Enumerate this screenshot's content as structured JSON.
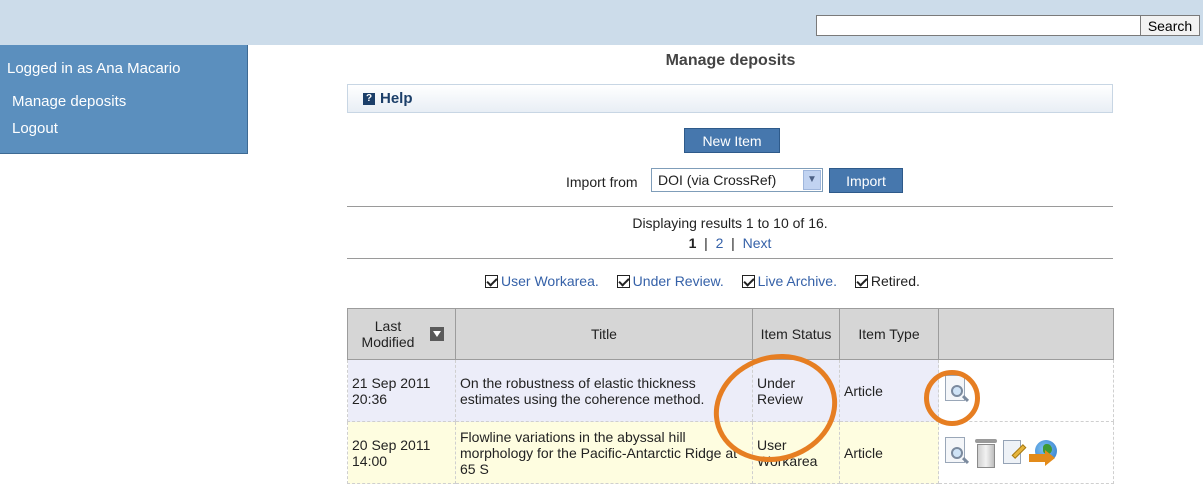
{
  "header": {
    "search_placeholder": "",
    "search_button": "Search"
  },
  "sidebar": {
    "logged_in": "Logged in as Ana Macario",
    "items": [
      {
        "label": "Manage deposits"
      },
      {
        "label": "Logout"
      }
    ]
  },
  "main": {
    "title": "Manage deposits",
    "help_label": "Help",
    "new_item_label": "New Item",
    "import": {
      "label": "Import from",
      "selected": "DOI (via CrossRef)",
      "button": "Import"
    },
    "results_text": "Displaying results 1 to 10 of 16.",
    "pager": {
      "current": "1",
      "sep": "|",
      "page2": "2",
      "next": "Next"
    },
    "filters": [
      {
        "label": "User Workarea.",
        "checked": true
      },
      {
        "label": "Under Review.",
        "checked": true
      },
      {
        "label": "Live Archive.",
        "checked": true
      },
      {
        "label": "Retired.",
        "checked": true
      }
    ]
  },
  "table": {
    "headers": {
      "last_modified": "Last Modified",
      "title": "Title",
      "item_status": "Item Status",
      "item_type": "Item Type"
    },
    "rows": [
      {
        "date": "21 Sep 2011 20:36",
        "title": "On the robustness of elastic thickness estimates using the coherence method.",
        "status": "Under Review",
        "type": "Article",
        "actions": [
          "preview-icon"
        ]
      },
      {
        "date": "20 Sep 2011 14:00",
        "title": "Flowline variations in the abyssal hill morphology for the Pacific-Antarctic Ridge at 65 S",
        "status": "User Workarea",
        "type": "Article",
        "actions": [
          "preview-icon",
          "trash-icon",
          "edit-icon",
          "deposit-globe-icon"
        ]
      }
    ]
  },
  "colors": {
    "topbar": "#ccdcea",
    "sidebar": "#5b8fbe",
    "button_blue": "#4677ad",
    "link": "#3561a8",
    "highlight": "#e67e22"
  }
}
